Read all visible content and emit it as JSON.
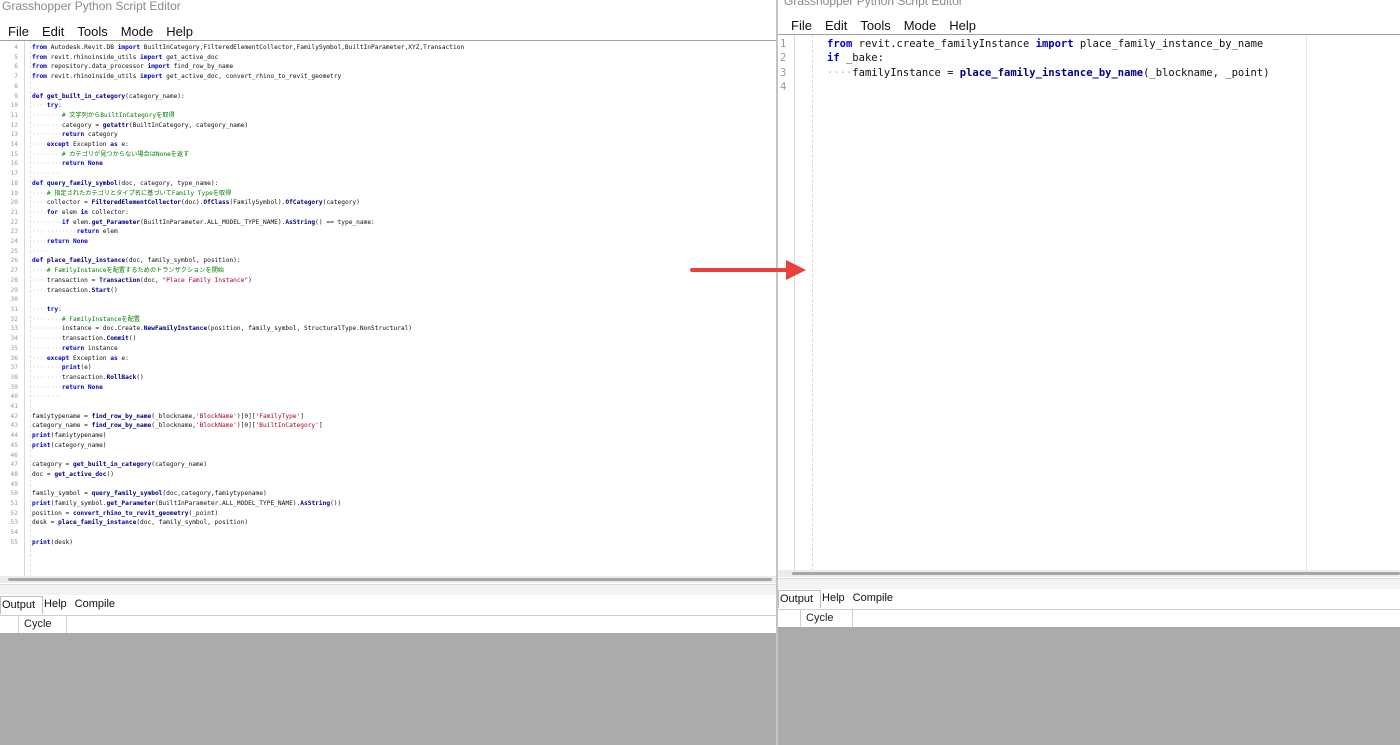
{
  "left_window": {
    "title": "Grasshopper Python Script Editor",
    "menu": [
      "File",
      "Edit",
      "Tools",
      "Mode",
      "Help"
    ],
    "code_lines": [
      {
        "n": "4",
        "html": "<span class=\"kw\">from</span> Autodesk.Revit.DB <span class=\"kw\">import</span> BuiltInCategory,FilteredElementCollector,FamilySymbol,BuiltInParameter,XYZ,Transaction"
      },
      {
        "n": "5",
        "html": "<span class=\"kw\">from</span> revit.rhinoinside_utils <span class=\"kw\">import</span> get_active_doc"
      },
      {
        "n": "6",
        "html": "<span class=\"kw\">from</span> repository.data_processor <span class=\"kw\">import</span> find_row_by_name"
      },
      {
        "n": "7",
        "html": "<span class=\"kw\">from</span> revit.rhinoinside_utils <span class=\"kw\">import</span> get_active_doc, convert_rhino_to_revit_geometry"
      },
      {
        "n": "8",
        "html": ""
      },
      {
        "n": "9",
        "html": "<span class=\"kw\">def</span> <span class=\"fn\">get_built_in_category</span>(category_name):"
      },
      {
        "n": "10",
        "html": "<span class=\"dim\">····</span><span class=\"kw\">try</span>:"
      },
      {
        "n": "11",
        "html": "<span class=\"dim\">········</span><span class=\"cm\"># 文字列からBuiltInCategoryを取得</span>"
      },
      {
        "n": "12",
        "html": "<span class=\"dim\">········</span>category = <span class=\"fn\">getattr</span>(BuiltInCategory, category_name)"
      },
      {
        "n": "13",
        "html": "<span class=\"dim\">········</span><span class=\"kw\">return</span> category"
      },
      {
        "n": "14",
        "html": "<span class=\"dim\">····</span><span class=\"kw\">except</span> Exception <span class=\"kw\">as</span> e:"
      },
      {
        "n": "15",
        "html": "<span class=\"dim\">········</span><span class=\"cm\"># カテゴリが見つからない場合はNoneを返す</span>"
      },
      {
        "n": "16",
        "html": "<span class=\"dim\">········</span><span class=\"kw\">return</span> <span class=\"kw\">None</span>"
      },
      {
        "n": "17",
        "html": "<span class=\"dim\">········</span>"
      },
      {
        "n": "18",
        "html": "<span class=\"kw\">def</span> <span class=\"fn\">query_family_symbol</span>(doc, category, type_name):"
      },
      {
        "n": "19",
        "html": "<span class=\"dim\">····</span><span class=\"cm\"># 指定されたカテゴリとタイプ名に基づいてFamily Typeを取得</span>"
      },
      {
        "n": "20",
        "html": "<span class=\"dim\">····</span>collector = <span class=\"fn\">FilteredElementCollector</span>(doc).<span class=\"fn\">OfClass</span>(FamilySymbol).<span class=\"fn\">OfCategory</span>(category)"
      },
      {
        "n": "21",
        "html": "<span class=\"dim\">····</span><span class=\"kw\">for</span> elem <span class=\"kw\">in</span> collector:"
      },
      {
        "n": "22",
        "html": "<span class=\"dim\">········</span><span class=\"kw\">if</span> elem.<span class=\"fn\">get_Parameter</span>(BuiltInParameter.ALL_MODEL_TYPE_NAME).<span class=\"fn\">AsString</span>() == type_name:"
      },
      {
        "n": "23",
        "html": "<span class=\"dim\">············</span><span class=\"kw\">return</span> elem"
      },
      {
        "n": "24",
        "html": "<span class=\"dim\">····</span><span class=\"kw\">return</span> <span class=\"kw\">None</span>"
      },
      {
        "n": "25",
        "html": "<span class=\"dim\">····</span>"
      },
      {
        "n": "26",
        "html": "<span class=\"kw\">def</span> <span class=\"fn\">place_family_instance</span>(doc, family_symbol, position):"
      },
      {
        "n": "27",
        "html": "<span class=\"dim\">····</span><span class=\"cm\"># FamilyInstanceを配置するためのトランザクションを開始</span>"
      },
      {
        "n": "28",
        "html": "<span class=\"dim\">····</span>transaction = <span class=\"fn\">Transaction</span>(doc, <span class=\"str\">\"Place Family Instance\"</span>)"
      },
      {
        "n": "29",
        "html": "<span class=\"dim\">····</span>transaction.<span class=\"fn\">Start</span>()"
      },
      {
        "n": "30",
        "html": ""
      },
      {
        "n": "31",
        "html": "<span class=\"dim\">····</span><span class=\"kw\">try</span>:"
      },
      {
        "n": "32",
        "html": "<span class=\"dim\">········</span><span class=\"cm\"># FamilyInstanceを配置</span>"
      },
      {
        "n": "33",
        "html": "<span class=\"dim\">········</span>instance = doc.Create.<span class=\"fn\">NewFamilyInstance</span>(position, family_symbol, StructuralType.NonStructural)"
      },
      {
        "n": "34",
        "html": "<span class=\"dim\">········</span>transaction.<span class=\"fn\">Commit</span>()"
      },
      {
        "n": "35",
        "html": "<span class=\"dim\">········</span><span class=\"kw\">return</span> instance"
      },
      {
        "n": "36",
        "html": "<span class=\"dim\">····</span><span class=\"kw\">except</span> Exception <span class=\"kw\">as</span> e:"
      },
      {
        "n": "37",
        "html": "<span class=\"dim\">········</span><span class=\"kw\">print</span>(e)"
      },
      {
        "n": "38",
        "html": "<span class=\"dim\">········</span>transaction.<span class=\"fn\">RollBack</span>()"
      },
      {
        "n": "39",
        "html": "<span class=\"dim\">········</span><span class=\"kw\">return</span> <span class=\"kw\">None</span>"
      },
      {
        "n": "40",
        "html": "<span class=\"dim\">········</span>"
      },
      {
        "n": "41",
        "html": ""
      },
      {
        "n": "42",
        "html": "famiytypename = <span class=\"fn\">find_row_by_name</span>(_blockname,<span class=\"str\">'BlockName'</span>)[0][<span class=\"str\">'FamilyType'</span>]"
      },
      {
        "n": "43",
        "html": "category_name = <span class=\"fn\">find_row_by_name</span>(_blockname,<span class=\"str\">'BlockName'</span>)[0][<span class=\"str\">'BuiltInCategory'</span>]"
      },
      {
        "n": "44",
        "html": "<span class=\"kw\">print</span>(famiytypename)"
      },
      {
        "n": "45",
        "html": "<span class=\"kw\">print</span>(category_name)"
      },
      {
        "n": "46",
        "html": ""
      },
      {
        "n": "47",
        "html": "category = <span class=\"fn\">get_built_in_category</span>(category_name)"
      },
      {
        "n": "48",
        "html": "doc = <span class=\"fn\">get_active_doc</span>()"
      },
      {
        "n": "49",
        "html": ""
      },
      {
        "n": "50",
        "html": "family_symbol = <span class=\"fn\">query_family_symbol</span>(doc,category,famiytypename)"
      },
      {
        "n": "51",
        "html": "<span class=\"kw\">print</span>(family_symbol.<span class=\"fn\">get_Parameter</span>(BuiltInParameter.ALL_MODEL_TYPE_NAME).<span class=\"fn\">AsString</span>())"
      },
      {
        "n": "52",
        "html": "position = <span class=\"fn\">convert_rhino_to_revit_geometry</span>(_point)"
      },
      {
        "n": "53",
        "html": "desk = <span class=\"fn\">place_family_instance</span>(doc, family_symbol, position)"
      },
      {
        "n": "54",
        "html": ""
      },
      {
        "n": "55",
        "html": "<span class=\"kw\">print</span>(desk)"
      }
    ],
    "output_tabs": [
      "Output",
      "Help",
      "Compile"
    ],
    "output_column": "Cycle"
  },
  "right_window": {
    "title": "Grasshopper Python Script Editor",
    "menu": [
      "File",
      "Edit",
      "Tools",
      "Mode",
      "Help"
    ],
    "code_lines": [
      {
        "n": "1",
        "html": "<span class=\"kw\">from</span> revit.create_familyInstance <span class=\"kw\">import</span> place_family_instance_by_name"
      },
      {
        "n": "2",
        "html": "<span class=\"kw\">if</span> _bake:"
      },
      {
        "n": "3",
        "html": "<span class=\"dim\">····</span>familyInstance = <span class=\"fn\">place_family_instance_by_name</span>(_blockname, _point)"
      },
      {
        "n": "4",
        "html": ""
      }
    ],
    "output_tabs": [
      "Output",
      "Help",
      "Compile"
    ],
    "output_column": "Cycle"
  },
  "colors": {
    "arrow": "#e8413b",
    "keyword": "#0000cc",
    "comment": "#008000",
    "string": "#b00020",
    "output_bg": "#ababab"
  }
}
